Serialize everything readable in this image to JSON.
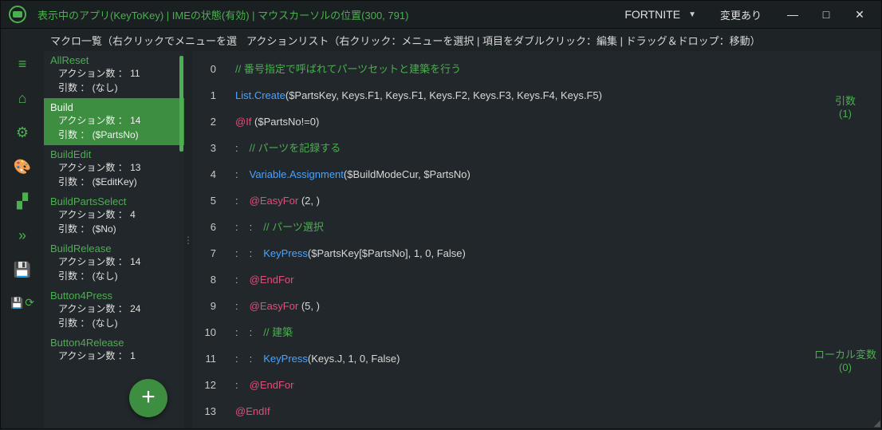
{
  "titlebar": {
    "status": "表示中のアプリ(KeyToKey)  |  IMEの状態(有効)  |  マウスカーソルの位置(300, 791)",
    "profile": "FORTNITE",
    "changed": "変更あり"
  },
  "subheader": {
    "left": "マクロ一覧（右クリックでメニューを選",
    "right": "アクションリスト（右クリック：メニューを選択  |  項目をダブルクリック：編集  |  ドラッグ＆ドロップ：移動）"
  },
  "macros": [
    {
      "name": "AllReset",
      "count": "アクション数 ： 11",
      "args": "引数 ： (なし)",
      "selected": false
    },
    {
      "name": "Build",
      "count": "アクション数 ： 14",
      "args": "引数 ： ($PartsNo)",
      "selected": true
    },
    {
      "name": "BuildEdit",
      "count": "アクション数 ： 13",
      "args": "引数 ： ($EditKey)",
      "selected": false
    },
    {
      "name": "BuildPartsSelect",
      "count": "アクション数 ： 4",
      "args": "引数 ： ($No)",
      "selected": false
    },
    {
      "name": "BuildRelease",
      "count": "アクション数 ： 14",
      "args": "引数 ： (なし)",
      "selected": false
    },
    {
      "name": "Button4Press",
      "count": "アクション数 ： 24",
      "args": "引数 ： (なし)",
      "selected": false
    },
    {
      "name": "Button4Release",
      "count": "アクション数 ： 1",
      "args": "",
      "selected": false
    }
  ],
  "code_lines": [
    {
      "n": "0",
      "indent": 0,
      "tokens": [
        {
          "t": "comment",
          "v": "// 番号指定で呼ばれてパーツセットと建築を行う"
        }
      ]
    },
    {
      "n": "1",
      "indent": 0,
      "tokens": [
        {
          "t": "call",
          "v": "List.Create"
        },
        {
          "t": "plain",
          "v": "($PartsKey, Keys.F1, Keys.F1, Keys.F2, Keys.F3, Keys.F4, Keys.F5)"
        }
      ]
    },
    {
      "n": "2",
      "indent": 0,
      "tokens": [
        {
          "t": "dir",
          "v": "@If "
        },
        {
          "t": "plain",
          "v": "($PartsNo!=0)"
        }
      ]
    },
    {
      "n": "3",
      "indent": 1,
      "tokens": [
        {
          "t": "comment",
          "v": "// パーツを記録する"
        }
      ]
    },
    {
      "n": "4",
      "indent": 1,
      "tokens": [
        {
          "t": "call",
          "v": "Variable.Assignment"
        },
        {
          "t": "plain",
          "v": "($BuildModeCur, $PartsNo)"
        }
      ]
    },
    {
      "n": "5",
      "indent": 1,
      "tokens": [
        {
          "t": "dir",
          "v": "@EasyFor "
        },
        {
          "t": "plain",
          "v": "(2, )"
        }
      ]
    },
    {
      "n": "6",
      "indent": 2,
      "tokens": [
        {
          "t": "comment",
          "v": "// パーツ選択"
        }
      ]
    },
    {
      "n": "7",
      "indent": 2,
      "tokens": [
        {
          "t": "call",
          "v": "KeyPress"
        },
        {
          "t": "plain",
          "v": "($PartsKey[$PartsNo], 1, 0, False)"
        }
      ]
    },
    {
      "n": "8",
      "indent": 1,
      "tokens": [
        {
          "t": "dir",
          "v": "@EndFor"
        }
      ]
    },
    {
      "n": "9",
      "indent": 1,
      "tokens": [
        {
          "t": "dir",
          "v": "@EasyFor "
        },
        {
          "t": "plain",
          "v": "(5, )"
        }
      ]
    },
    {
      "n": "10",
      "indent": 2,
      "tokens": [
        {
          "t": "comment",
          "v": "// 建築"
        }
      ]
    },
    {
      "n": "11",
      "indent": 2,
      "tokens": [
        {
          "t": "call",
          "v": "KeyPress"
        },
        {
          "t": "plain",
          "v": "(Keys.J, 1, 0, False)"
        }
      ]
    },
    {
      "n": "12",
      "indent": 1,
      "tokens": [
        {
          "t": "dir",
          "v": "@EndFor"
        }
      ]
    },
    {
      "n": "13",
      "indent": 0,
      "tokens": [
        {
          "t": "dir",
          "v": "@EndIf"
        }
      ]
    }
  ],
  "right_panel": {
    "args_label": "引数",
    "args_count": "(1)",
    "locals_label": "ローカル変数",
    "locals_count": "(0)"
  },
  "fab_label": "+"
}
